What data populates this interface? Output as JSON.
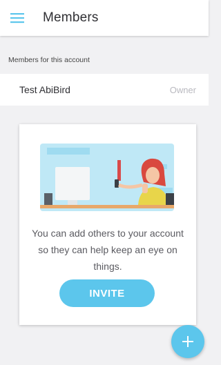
{
  "appbar": {
    "title": "Members",
    "menu_icon": "hamburger-menu-icon"
  },
  "members": {
    "section_header": "Members for this account",
    "list": [
      {
        "name": "Test AbiBird",
        "role": "Owner"
      }
    ]
  },
  "invite_card": {
    "illustration": "woman-at-desk-with-phone-illustration",
    "description": "You can add others to your account so they can help keep an eye on things.",
    "button_label": "INVITE"
  },
  "fab": {
    "icon": "plus-icon"
  },
  "colors": {
    "accent": "#5cc6ec",
    "background": "#f1f1f3",
    "card": "#ffffff"
  }
}
